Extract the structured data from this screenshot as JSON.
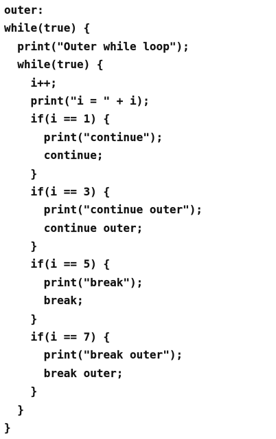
{
  "code_lines": [
    "outer:",
    "while(true) {",
    "  print(\"Outer while loop\");",
    "  while(true) {",
    "    i++;",
    "    print(\"i = \" + i);",
    "    if(i == 1) {",
    "      print(\"continue\");",
    "      continue;",
    "    }",
    "    if(i == 3) {",
    "      print(\"continue outer\");",
    "      continue outer;",
    "    }",
    "    if(i == 5) {",
    "      print(\"break\");",
    "      break;",
    "    }",
    "    if(i == 7) {",
    "      print(\"break outer\");",
    "      break outer;",
    "    }",
    "  }",
    "}"
  ]
}
